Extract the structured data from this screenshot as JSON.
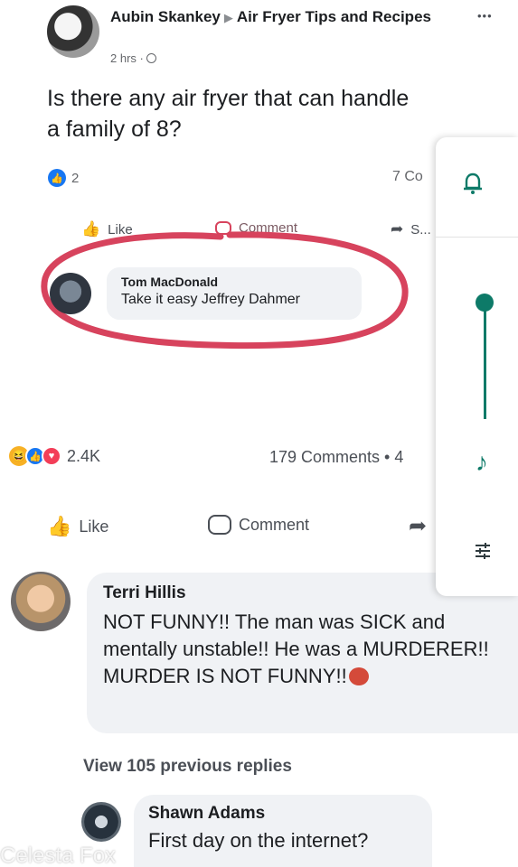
{
  "post": {
    "author": "Aubin Skankey",
    "group": "Air Fryer Tips and Recipes",
    "time": "2 hrs · ",
    "text": "Is there any air fryer that can handle a family of 8?",
    "like_count": "2",
    "comments_count_partial": "7 Co",
    "more_icon": "•••"
  },
  "inner_actions": {
    "like": "Like",
    "comment": "Comment",
    "share": "S..."
  },
  "highlighted_comment": {
    "author": "Tom MacDonald",
    "text": "Take it easy Jeffrey Dahmer"
  },
  "share_stats": {
    "reactions": "2.4K",
    "comments": "179 Comments • 4"
  },
  "outer_actions": {
    "like": "Like",
    "comment": "Comment"
  },
  "comment_terri": {
    "author": "Terri Hillis",
    "text": "NOT FUNNY!! The man was SICK and mentally unstable!! He was a MURDERER!! MURDER IS NOT FUNNY!!"
  },
  "view_replies": "View 105 previous replies",
  "comment_shawn": {
    "author": "Shawn Adams",
    "text": "First day on the internet?"
  },
  "watermark": "Celesta Fox",
  "colors": {
    "accent": "#1877f2",
    "highlight_ring": "#d7435d",
    "panel_teal": "#0d7a68"
  }
}
